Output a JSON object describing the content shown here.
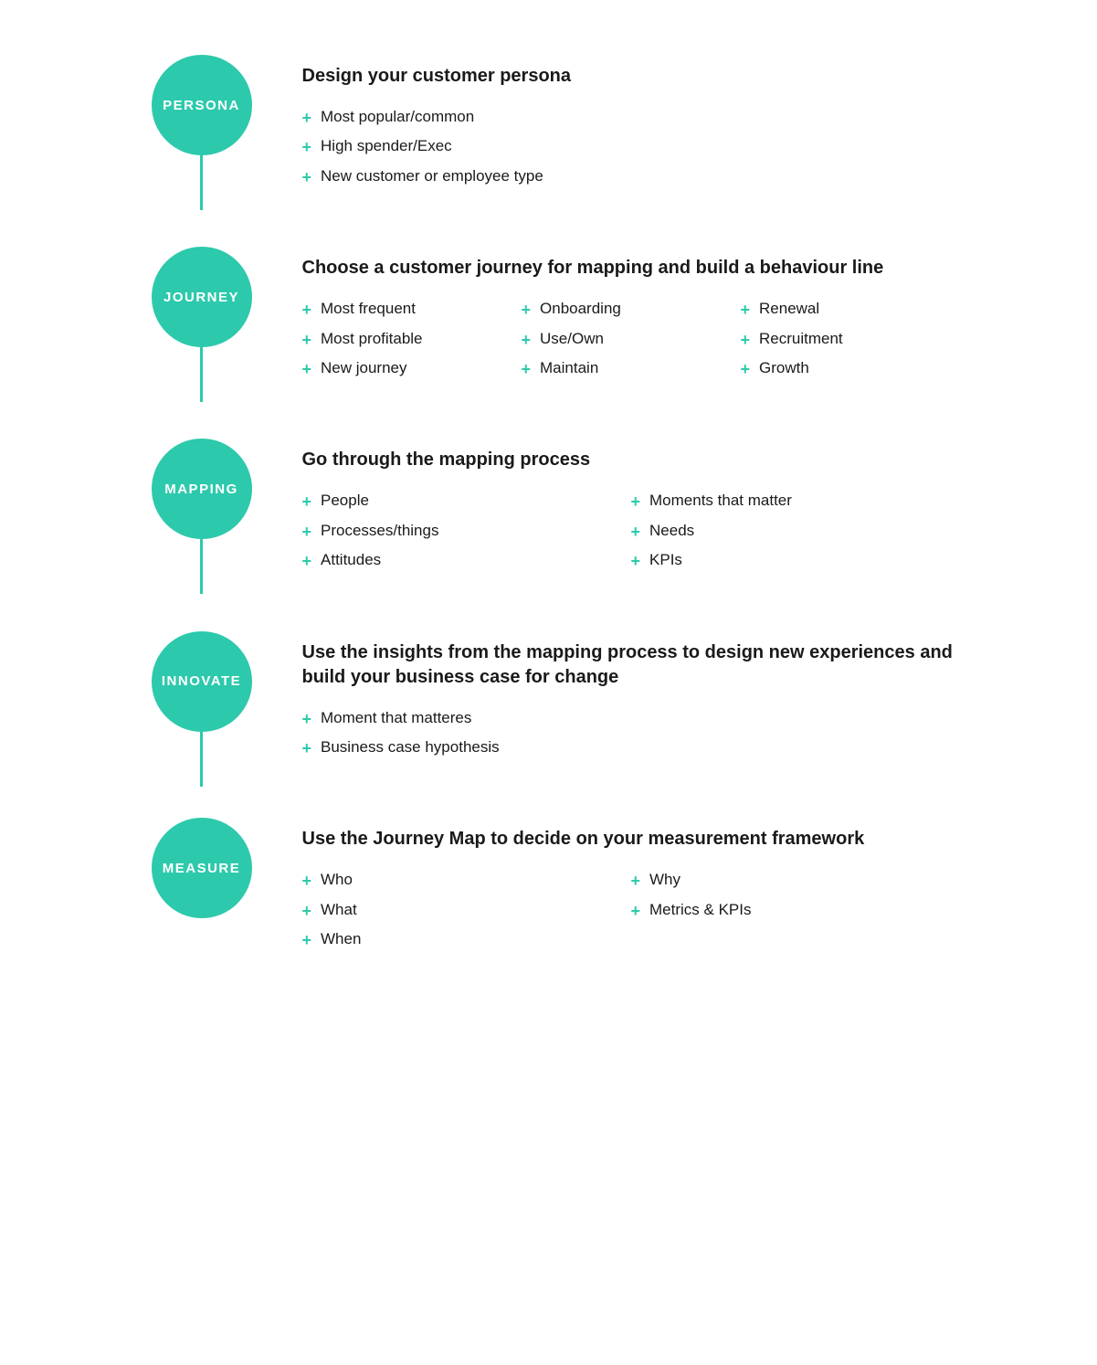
{
  "steps": [
    {
      "id": "persona",
      "label": "PERSONA",
      "title": "Design your customer persona",
      "lists": [
        {
          "columns": 1,
          "items": [
            [
              "Most popular/common"
            ],
            [
              "High spender/Exec"
            ],
            [
              "New customer or employee type"
            ]
          ]
        }
      ]
    },
    {
      "id": "journey",
      "label": "JOURNEY",
      "title": "Choose a customer journey for mapping and build a behaviour line",
      "lists": [
        {
          "columns": 3,
          "col1": [
            "Most frequent",
            "Most profitable",
            "New journey"
          ],
          "col2": [
            "Onboarding",
            "Use/Own",
            "Maintain"
          ],
          "col3": [
            "Renewal",
            "Recruitment",
            "Growth"
          ]
        }
      ]
    },
    {
      "id": "mapping",
      "label": "MAPPING",
      "title": "Go through the mapping process",
      "lists": [
        {
          "columns": 2,
          "col1": [
            "People",
            "Processes/things",
            "Attitudes"
          ],
          "col2": [
            "Moments that matter",
            "Needs",
            "KPIs"
          ]
        }
      ]
    },
    {
      "id": "innovate",
      "label": "INNOVATE",
      "title": "Use the insights from the mapping process to design new experiences and build your business case for change",
      "lists": [
        {
          "columns": 1,
          "items": [
            [
              "Moment that matteres"
            ],
            [
              "Business case hypothesis"
            ]
          ]
        }
      ]
    },
    {
      "id": "measure",
      "label": "MEASURE",
      "title": "Use the Journey Map to decide on your measurement framework",
      "lists": [
        {
          "columns": 2,
          "col1": [
            "Who",
            "What",
            "When"
          ],
          "col2": [
            "Why",
            "Metrics & KPIs"
          ]
        }
      ]
    }
  ],
  "accent_color": "#2DC9AC"
}
